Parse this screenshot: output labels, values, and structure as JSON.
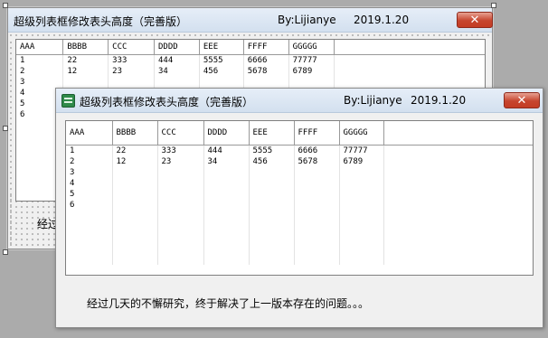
{
  "window_title": "超级列表框修改表头高度（完善版）",
  "author": "By:Lijianye",
  "date": "2019.1.20",
  "close_label": "✕",
  "columns": [
    "AAA",
    "BBBB",
    "CCC",
    "DDDD",
    "EEE",
    "FFFF",
    "GGGGG"
  ],
  "rows": [
    [
      "1",
      "22",
      "333",
      "444",
      "5555",
      "6666",
      "77777"
    ],
    [
      "2",
      "12",
      "23",
      "34",
      "456",
      "5678",
      "6789"
    ],
    [
      "3",
      "",
      "",
      "",
      "",
      "",
      ""
    ],
    [
      "4",
      "",
      "",
      "",
      "",
      "",
      ""
    ],
    [
      "5",
      "",
      "",
      "",
      "",
      "",
      ""
    ],
    [
      "6",
      "",
      "",
      "",
      "",
      "",
      ""
    ]
  ],
  "message": "经过几天的不懈研究，终于解决了上一版本存在的问题。。。",
  "back_message_partial": "经过"
}
